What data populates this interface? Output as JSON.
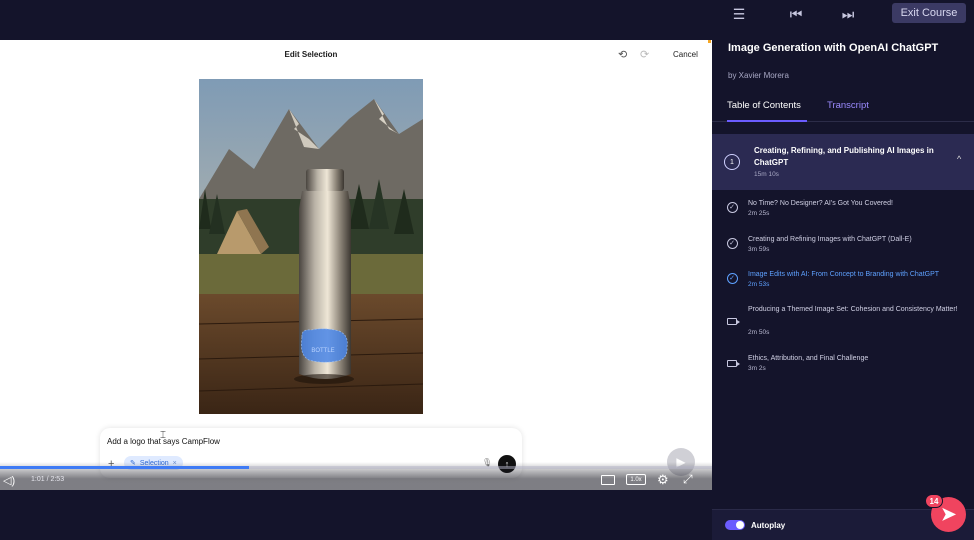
{
  "topbar": {
    "menu_icon": "list-icon",
    "prev_icon": "skip-previous-icon",
    "next_icon": "skip-next-icon",
    "exit_label": "Exit Course"
  },
  "editor": {
    "title": "Edit Selection",
    "cancel_label": "Cancel",
    "bottle_text": "BOTTLE",
    "prompt_value": "Add a logo that says CampFlow",
    "selection_chip": "Selection"
  },
  "player": {
    "time": "1:01 / 2:53",
    "speed": "1.0x",
    "progress": 0.35
  },
  "sidebar": {
    "course_title": "Image Generation with OpenAI ChatGPT",
    "author": "by Xavier Morera",
    "tabs": [
      "Table of Contents",
      "Transcript"
    ],
    "module": {
      "number": "1",
      "title": "Creating, Refining, and Publishing AI Images in ChatGPT",
      "duration": "15m 10s"
    },
    "clips": [
      {
        "title": "No Time? No Designer? AI's Got You Covered!",
        "duration": "2m 25s",
        "status": "watched"
      },
      {
        "title": "Creating and Refining Images with ChatGPT (Dall-E)",
        "duration": "3m 59s",
        "status": "watched"
      },
      {
        "title": "Image Edits with AI: From Concept to Branding with ChatGPT",
        "duration": "2m 53s",
        "status": "active"
      },
      {
        "title": "Producing a Themed Image Set: Cohesion and Consistency Matter!",
        "duration": "2m 50s",
        "status": "unwatched"
      },
      {
        "title": "Ethics, Attribution, and Final Challenge",
        "duration": "3m 2s",
        "status": "unwatched"
      }
    ],
    "autoplay_label": "Autoplay",
    "notification_count": "14"
  },
  "colors": {
    "background": "#14142b",
    "accent": "#6b5cff",
    "active_clip": "#5ea1ff",
    "fab": "#f0445f"
  }
}
